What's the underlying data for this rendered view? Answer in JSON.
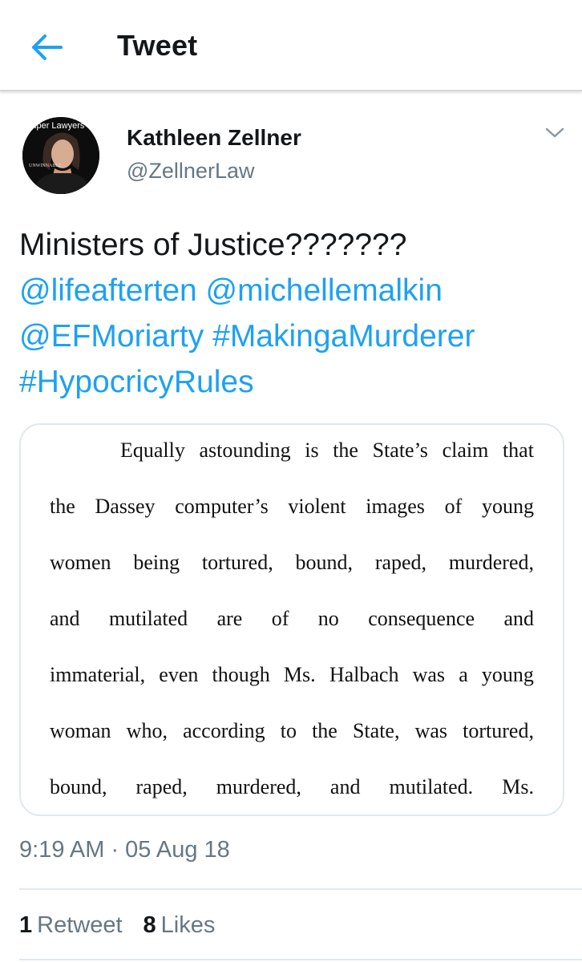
{
  "header": {
    "title": "Tweet",
    "back_icon": "arrow-left-icon",
    "accent_color": "#1da1f2"
  },
  "author": {
    "name": "Kathleen Zellner",
    "handle": "@ZellnerLaw",
    "avatar_badge_text": "Super Lawyers",
    "avatar_caption": "UNWINNABLE"
  },
  "tweet": {
    "text_plain": "Ministers of Justice???????",
    "mentions": [
      "@lifeafterten",
      "@michellemalkin",
      "@EFMoriarty"
    ],
    "hashtags": [
      "#MakingaMurderer",
      "#HypocricyRules"
    ]
  },
  "media": {
    "document_lines": [
      [
        "Equally",
        "astounding",
        "is",
        "the",
        "State’s",
        "claim",
        "that"
      ],
      [
        "the",
        "Dassey",
        "computer’s",
        "violent",
        "images",
        "of",
        "young"
      ],
      [
        "women",
        "being",
        "tortured,",
        "bound,",
        "raped,",
        "murdered,"
      ],
      [
        "and",
        "mutilated",
        "are",
        "of",
        "no",
        "consequence",
        "and"
      ],
      [
        "immaterial,",
        "even",
        "though",
        "Ms.",
        "Halbach",
        "was",
        "a",
        "young"
      ],
      [
        "woman",
        "who,",
        "according",
        "to",
        "the",
        "State,",
        "was",
        "tortured,"
      ],
      [
        "bound,",
        "raped,",
        "murdered,",
        "and",
        "mutilated.",
        "Ms."
      ]
    ]
  },
  "meta": {
    "timestamp": "9:19 AM · 05 Aug 18"
  },
  "stats": {
    "retweets_count": "1",
    "retweets_label": "Retweet",
    "likes_count": "8",
    "likes_label": "Likes"
  }
}
